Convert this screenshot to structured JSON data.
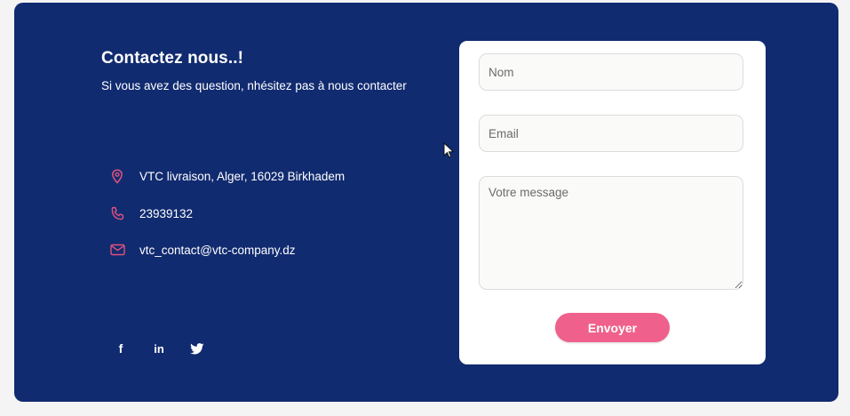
{
  "contact": {
    "title": "Contactez nous..!",
    "subtitle": "Si vous avez des question, nhésitez pas à nous contacter",
    "address": "VTC livraison, Alger, 16029 Birkhadem",
    "phone": "23939132",
    "email": "vtc_contact@vtc-company.dz",
    "icons": {
      "address": "map-pin-icon",
      "phone": "phone-icon",
      "email": "mail-icon"
    },
    "socials": [
      {
        "name": "facebook-icon",
        "glyph": "f"
      },
      {
        "name": "linkedin-icon",
        "glyph": "in"
      },
      {
        "name": "twitter-icon",
        "glyph": "bird"
      }
    ]
  },
  "form": {
    "name_placeholder": "Nom",
    "email_placeholder": "Email",
    "message_placeholder": "Votre message",
    "submit_label": "Envoyer"
  },
  "colors": {
    "card_background": "#112b70",
    "accent_pink": "#f0608c",
    "form_background": "#ffffff"
  }
}
